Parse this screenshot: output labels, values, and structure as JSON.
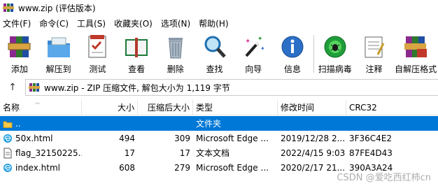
{
  "window": {
    "title": "www.zip (评估版本)"
  },
  "menu": [
    "文件(F)",
    "命令(C)",
    "工具(S)",
    "收藏夹(O)",
    "选项(N)",
    "帮助(H)"
  ],
  "toolbar": [
    {
      "label": "添加",
      "icon": "add-archive-icon"
    },
    {
      "label": "解压到",
      "icon": "extract-to-icon"
    },
    {
      "label": "测试",
      "icon": "test-archive-icon"
    },
    {
      "label": "查看",
      "icon": "view-book-icon"
    },
    {
      "label": "删除",
      "icon": "trash-icon"
    },
    {
      "label": "查找",
      "icon": "magnifier-icon"
    },
    {
      "label": "向导",
      "icon": "wizard-wand-icon"
    },
    {
      "label": "信息",
      "icon": "info-icon"
    },
    {
      "label": "扫描病毒",
      "icon": "virus-scan-icon"
    },
    {
      "label": "注释",
      "icon": "comment-icon"
    },
    {
      "label": "自解压格式",
      "icon": "sfx-icon"
    }
  ],
  "address": {
    "path": "www.zip - ZIP 压缩文件, 解包大小为 1,119 字节"
  },
  "columns": {
    "name": "名称",
    "size": "大小",
    "packed": "压缩后大小",
    "type": "类型",
    "modified": "修改时间",
    "crc": "CRC32"
  },
  "files": [
    {
      "name": "..",
      "size": "",
      "packed": "",
      "type": "文件夹",
      "modified": "",
      "crc": "",
      "selected": true,
      "icon": "folder-up-icon"
    },
    {
      "name": "50x.html",
      "size": "494",
      "packed": "309",
      "type": "Microsoft Edge ...",
      "modified": "2019/12/28 2...",
      "crc": "3F36C4E2",
      "selected": false,
      "icon": "edge-html-icon"
    },
    {
      "name": "flag_32150225...",
      "size": "17",
      "packed": "17",
      "type": "文本文档",
      "modified": "2022/4/15 9:03",
      "crc": "87FE4D43",
      "selected": false,
      "icon": "text-file-icon"
    },
    {
      "name": "index.html",
      "size": "608",
      "packed": "279",
      "type": "Microsoft Edge ...",
      "modified": "2020/2/17 21...",
      "crc": "390A3A24",
      "selected": false,
      "icon": "edge-html-icon"
    }
  ],
  "watermark": "CSDN @爱吃西红柿cn"
}
